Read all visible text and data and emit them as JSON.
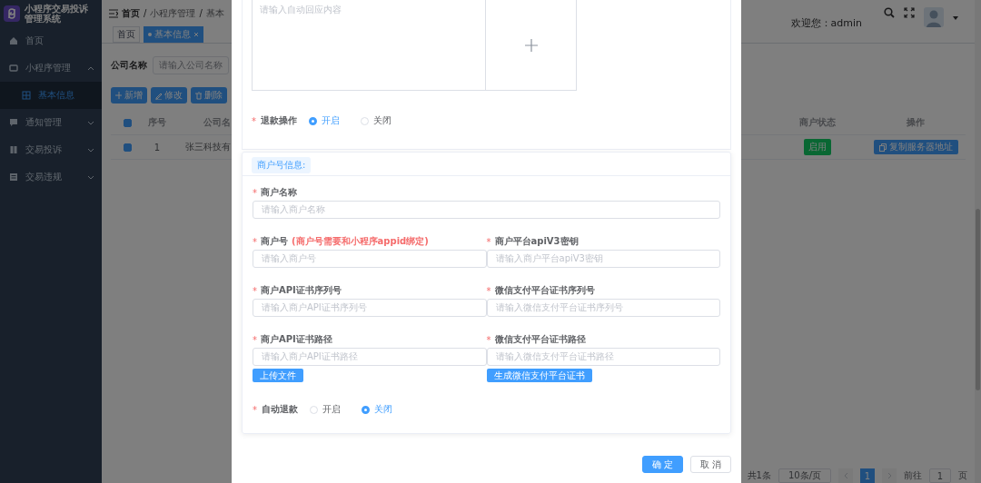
{
  "sidebar": {
    "title": [
      "小程序交易投诉",
      "管理系统"
    ],
    "items": [
      {
        "label": "首页",
        "kind": "link",
        "selected": false
      },
      {
        "label": "小程序管理",
        "kind": "submenu",
        "selected": false,
        "expanded": true,
        "children": [
          {
            "label": "基本信息",
            "selected": true
          }
        ]
      },
      {
        "label": "通知管理",
        "kind": "submenu",
        "selected": false,
        "expanded": false
      },
      {
        "label": "交易投诉",
        "kind": "submenu",
        "selected": false,
        "expanded": false
      },
      {
        "label": "交易违规",
        "kind": "submenu",
        "selected": false,
        "expanded": false
      }
    ]
  },
  "header": {
    "breadcrumb": [
      "首页",
      "小程序管理",
      "基本"
    ],
    "separators": [
      "/",
      "/"
    ],
    "welcome": "欢迎您：admin"
  },
  "tags": [
    {
      "label": "首页",
      "selected": false
    },
    {
      "label": "基本信息",
      "selected": true
    }
  ],
  "search": {
    "label": "公司名称",
    "placeholder": "请输入公司名称"
  },
  "toolbar": [
    {
      "label": "新增",
      "kind": "add"
    },
    {
      "label": "修改",
      "kind": "edit"
    },
    {
      "label": "删除",
      "kind": "delete"
    }
  ],
  "table": {
    "select_all": true,
    "columns": [
      "序号",
      "公司名",
      "商户状态",
      "操作"
    ],
    "rows": [
      {
        "checked": true,
        "cells": [
          "1",
          "张三科技有"
        ],
        "status": "启用",
        "action": "复制服务器地址"
      }
    ]
  },
  "pagination": {
    "total": "共1条",
    "page_size": "10条/页",
    "pages": [
      {
        "label": "1",
        "selected": true
      }
    ],
    "goto_label": "前往",
    "goto_value": "1",
    "goto_unit": "页"
  },
  "dialog": {
    "reply": {
      "placeholder": "请输入自动回应内容"
    },
    "refund": {
      "mark": "*",
      "label": "退款操作",
      "options": [
        {
          "label": "开启",
          "selected": true
        },
        {
          "label": "关闭",
          "selected": false
        }
      ]
    },
    "merchant": {
      "title": "商户号信息:",
      "rows": [
        [
          {
            "mark": "*",
            "label": "商户名称",
            "placeholder": "请输入商户名称"
          }
        ],
        [
          {
            "mark": "*",
            "label": "商户号",
            "note": "(商户号需要和小程序appid绑定)",
            "placeholder": "请输入商户号"
          },
          {
            "mark": "*",
            "label": "商户平台apiV3密钥",
            "placeholder": "请输入商户平台apiV3密钥"
          }
        ],
        [
          {
            "mark": "*",
            "label": "商户API证书序列号",
            "placeholder": "请输入商户API证书序列号"
          },
          {
            "mark": "*",
            "label": "微信支付平台证书序列号",
            "placeholder": "请输入微信支付平台证书序列号"
          }
        ],
        [
          {
            "mark": "*",
            "label": "商户API证书路径",
            "placeholder": "请输入商户API证书路径",
            "button": "上传文件"
          },
          {
            "mark": "*",
            "label": "微信支付平台证书路径",
            "placeholder": "请输入微信支付平台证书路径",
            "button": "生成微信支付平台证书"
          }
        ]
      ],
      "auto_refund": {
        "mark": "*",
        "label": "自动退款",
        "options": [
          {
            "label": "开启",
            "selected": false
          },
          {
            "label": "关闭",
            "selected": true
          }
        ]
      }
    },
    "buttons": [
      {
        "label": "确 定",
        "kind": "primary"
      },
      {
        "label": "取 消",
        "kind": "default"
      }
    ]
  }
}
